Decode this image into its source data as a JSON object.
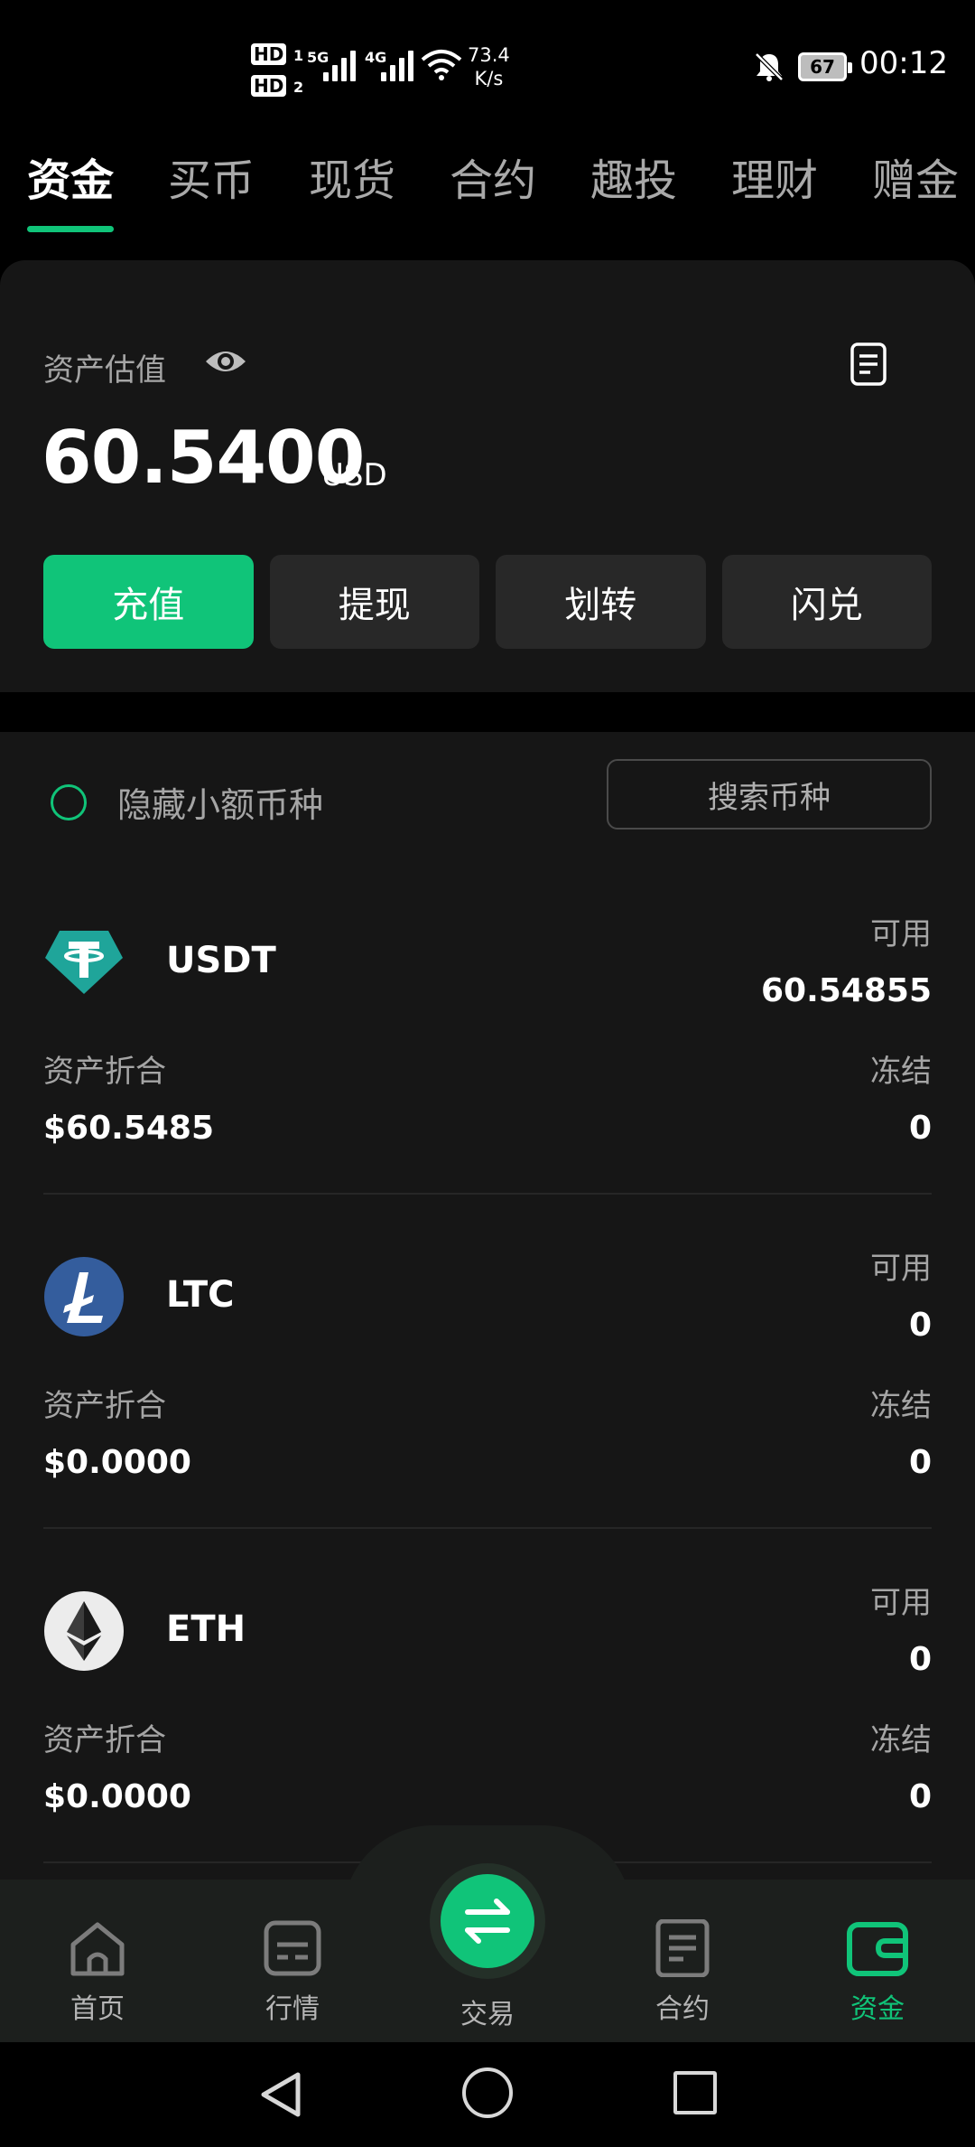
{
  "status_bar": {
    "hd1": "HD",
    "hd1_sub": "1",
    "hd2": "HD",
    "hd2_sub": "2",
    "net1": "5G",
    "net2": "4G",
    "speed_value": "73.4",
    "speed_unit": "K/s",
    "battery": "67",
    "time": "00:12",
    "icons": [
      "signal-icon",
      "wifi-icon",
      "mute-bell-icon",
      "battery-icon"
    ]
  },
  "top_tabs": [
    "资金",
    "买币",
    "现货",
    "合约",
    "趣投",
    "理财",
    "赠金"
  ],
  "active_tab": "资金",
  "asset_card": {
    "label": "资产估值",
    "value": "60.5400",
    "unit": "USD",
    "actions": [
      "充值",
      "提现",
      "划转",
      "闪兑"
    ]
  },
  "list_controls": {
    "hide_small_label": "隐藏小额币种",
    "search_label": "搜索币种"
  },
  "coins": [
    {
      "symbol": "USDT",
      "available_label": "可用",
      "available": "60.54855",
      "conv_label": "资产折合",
      "conv": "$60.5485",
      "frozen_label": "冻结",
      "frozen": "0"
    },
    {
      "symbol": "LTC",
      "available_label": "可用",
      "available": "0",
      "conv_label": "资产折合",
      "conv": "$0.0000",
      "frozen_label": "冻结",
      "frozen": "0"
    },
    {
      "symbol": "ETH",
      "available_label": "可用",
      "available": "0",
      "conv_label": "资产折合",
      "conv": "$0.0000",
      "frozen_label": "冻结",
      "frozen": "0"
    }
  ],
  "bottom_nav": {
    "items": [
      "首页",
      "行情",
      "交易",
      "合约",
      "资金"
    ],
    "active": "资金"
  },
  "colors": {
    "accent": "#10c479",
    "background": "#000000",
    "card": "#161616",
    "button": "#282828",
    "muted_text": "#a5a5a5"
  }
}
